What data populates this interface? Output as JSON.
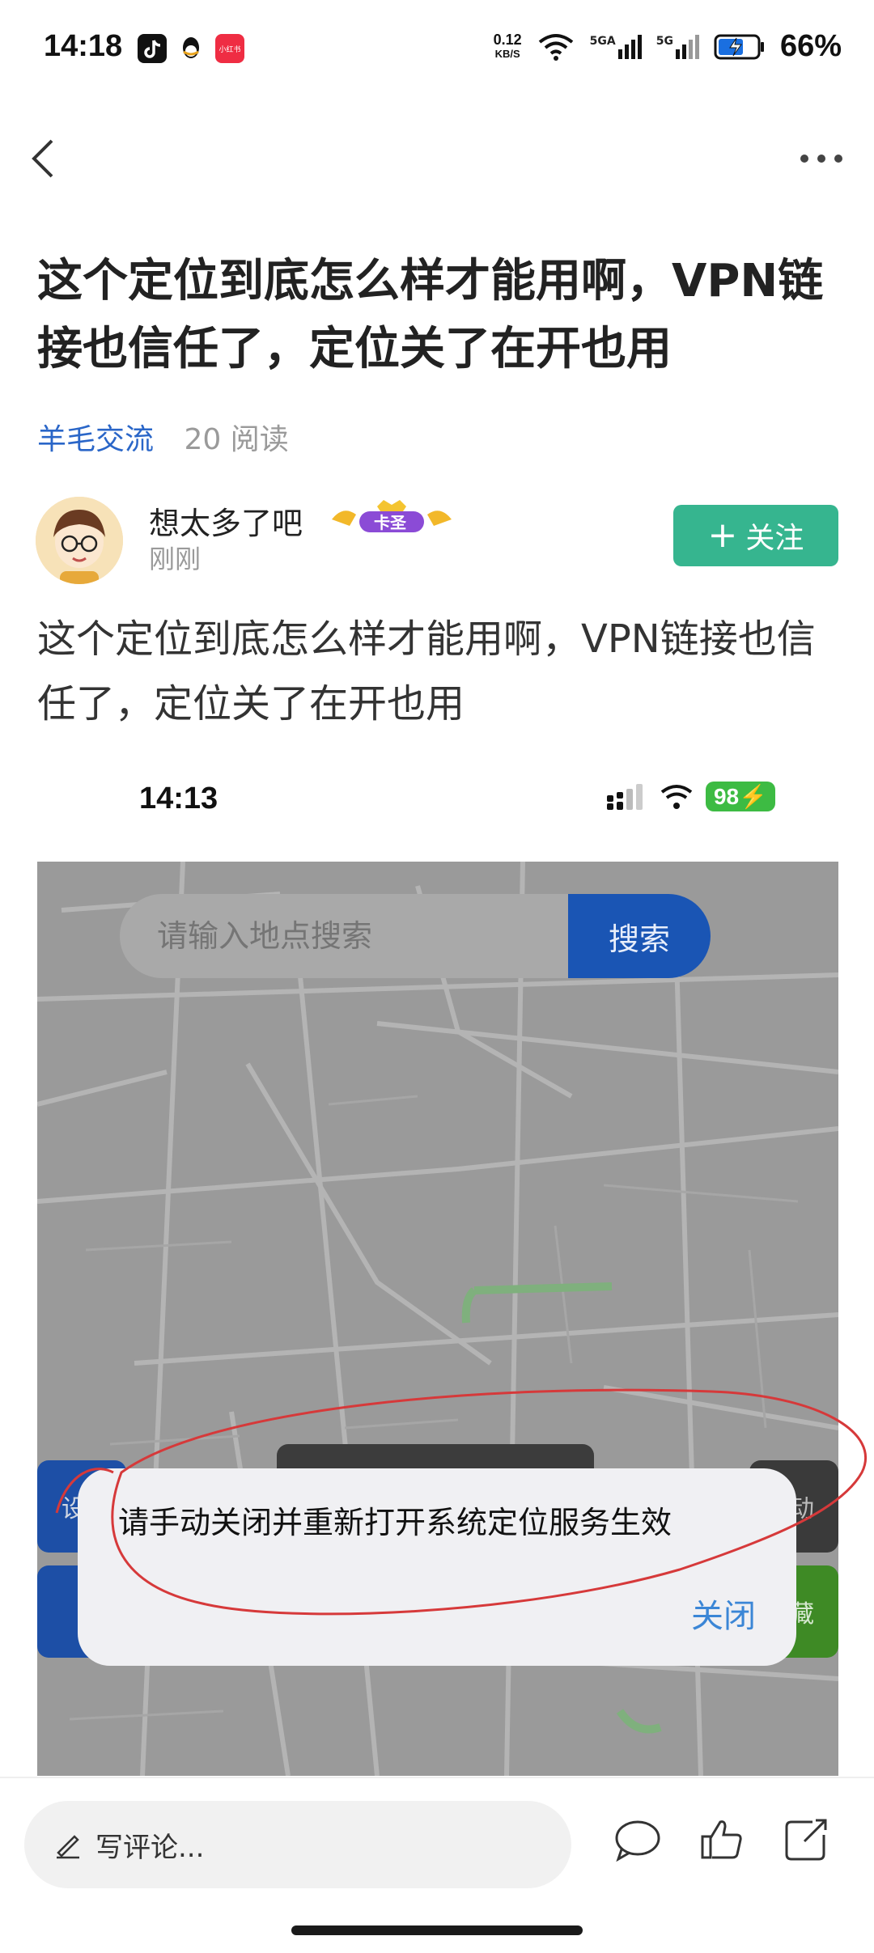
{
  "status_bar": {
    "time": "14:18",
    "app_icons": [
      "tiktok-icon",
      "qq-icon",
      "xiaohongshu-icon"
    ],
    "xiaohongshu_label": "小红书",
    "net_speed_value": "0.12",
    "net_speed_unit": "KB/S",
    "signal_1": "5GA",
    "signal_2": "5G",
    "battery": "66%"
  },
  "nav": {
    "back_icon": "chevron-left-icon",
    "more_icon": "more-icon"
  },
  "post": {
    "title": "这个定位到底怎么样才能用啊，VPN链接也信任了，定位关了在开也用",
    "tag": "羊毛交流",
    "reads": "20 阅读",
    "author": {
      "name": "想太多了吧",
      "badge": "卡圣",
      "time": "刚刚"
    },
    "follow_label": "关注",
    "body": "这个定位到底怎么样才能用啊，VPN链接也信任了，定位关了在开也用"
  },
  "screenshot": {
    "time": "14:13",
    "battery": "98",
    "search_placeholder": "请输入地点搜索",
    "search_button": "搜索",
    "side_left_1": "设",
    "side_right_1": "动",
    "side_right_2": "藏",
    "dialog_message": "请手动关闭并重新打开系统定位服务生效",
    "dialog_close": "关闭"
  },
  "bottom_bar": {
    "comment_placeholder": "写评论...",
    "icons": [
      "pencil-icon",
      "comment-icon",
      "like-icon",
      "share-icon"
    ]
  },
  "colors": {
    "tag": "#2a66c8",
    "follow_button": "#36b58f",
    "search_button": "#1a55b4",
    "dialog_link": "#3b86d6",
    "scribble": "#d6393a"
  }
}
